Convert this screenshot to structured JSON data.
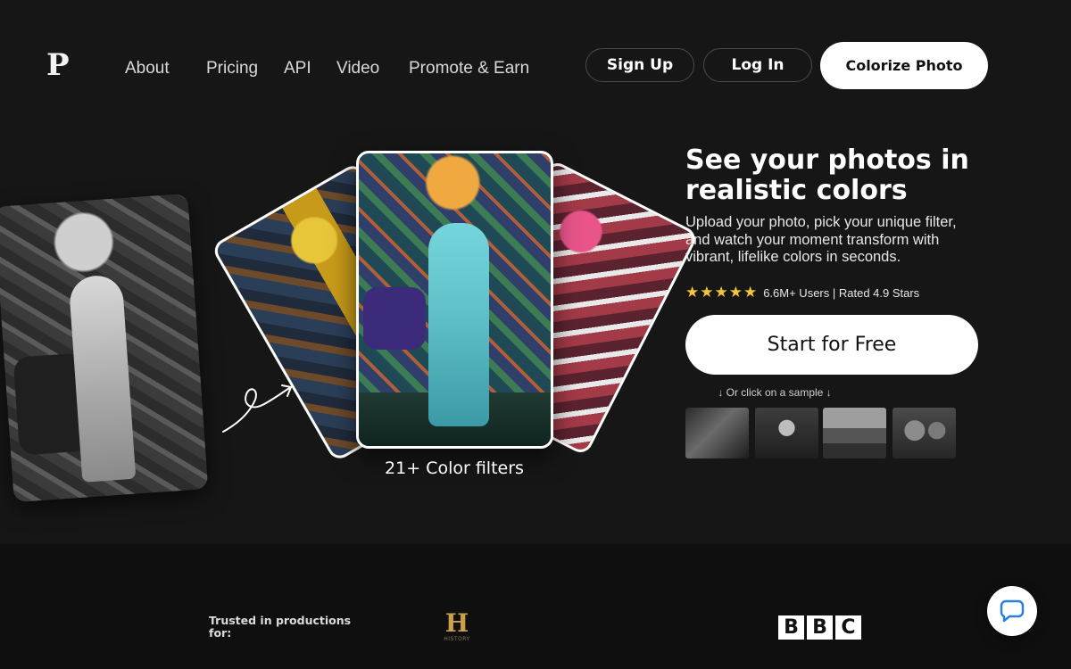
{
  "brand": {
    "logo_letter": "P"
  },
  "nav": {
    "items": [
      {
        "label": "About"
      },
      {
        "label": "Pricing"
      },
      {
        "label": "API"
      },
      {
        "label": "Video"
      },
      {
        "label": "Promote & Earn"
      }
    ],
    "signup_label": "Sign Up",
    "login_label": "Log In",
    "colorize_label": "Colorize Photo"
  },
  "showcase": {
    "filters_label": "21+ Color filters"
  },
  "hero": {
    "headline": "See your photos in realistic colors",
    "subcopy": "Upload your photo, pick your unique filter, and watch your moment transform with vibrant, lifelike colors in seconds.",
    "stars": "★★★★★",
    "rating_text": "6.6M+ Users | Rated 4.9 Stars",
    "rating_stars": 5,
    "cta_label": "Start for Free",
    "sample_hint": "↓ Or click on a sample ↓"
  },
  "footer": {
    "trusted_label": "Trusted in productions for:",
    "history_letter": "H",
    "history_sub": "HISTORY",
    "bbc_letters": [
      "B",
      "B",
      "C"
    ]
  },
  "colors": {
    "background": "#141313",
    "star": "#f5c242",
    "cta_background": "#ffffff"
  }
}
